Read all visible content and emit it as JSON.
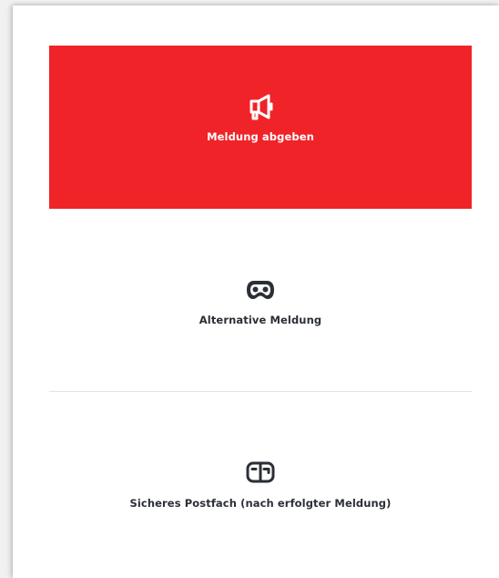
{
  "options": {
    "report": {
      "label": "Meldung abgeben",
      "icon": "megaphone-icon",
      "background": "#f02328",
      "text_color": "#ffffff"
    },
    "alternative": {
      "label": "Alternative Meldung",
      "icon": "mask-icon",
      "text_color": "#2b2f36"
    },
    "mailbox": {
      "label": "Sicheres Postfach (nach erfolgter Meldung)",
      "icon": "mailbox-icon",
      "text_color": "#2b2f36"
    }
  }
}
